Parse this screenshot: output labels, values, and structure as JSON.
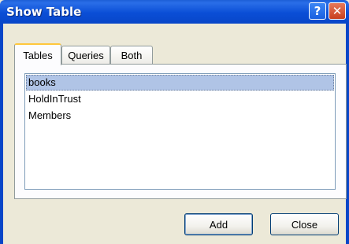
{
  "window": {
    "title": "Show Table"
  },
  "titlebar": {
    "help_glyph": "?",
    "close_glyph": "✕"
  },
  "tabs": [
    {
      "label": "Tables",
      "active": true
    },
    {
      "label": "Queries",
      "active": false
    },
    {
      "label": "Both",
      "active": false
    }
  ],
  "list": {
    "items": [
      {
        "label": "books",
        "selected": true
      },
      {
        "label": "HoldInTrust",
        "selected": false
      },
      {
        "label": "Members",
        "selected": false
      }
    ]
  },
  "buttons": {
    "add_label": "Add",
    "close_label": "Close"
  },
  "colors": {
    "titlebar": "#0a4ed6",
    "dialog_bg": "#ece9d8",
    "selection": "#b0c4e6",
    "active_tab_accent": "#ffc73c"
  }
}
